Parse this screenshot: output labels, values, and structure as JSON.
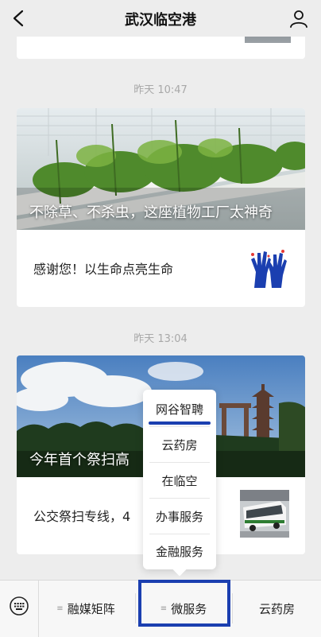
{
  "header": {
    "title": "武汉临空港",
    "back_icon": "chevron-left-icon",
    "profile_icon": "person-icon"
  },
  "feed": {
    "articles": [
      {
        "time": "昨天 10:47",
        "headline": "不除草、不杀虫，这座植物工厂太神奇",
        "sub_title": "感谢您！以生命点亮生命"
      },
      {
        "time": "昨天 13:04",
        "headline": "今年首个祭扫高",
        "sub_title": "公交祭扫专线，4"
      }
    ]
  },
  "popup_menu": {
    "items": [
      "网谷智聘",
      "云药房",
      "在临空",
      "办事服务",
      "金融服务"
    ]
  },
  "tabbar": {
    "keyboard_icon": "keyboard-icon",
    "tabs": [
      "融媒矩阵",
      "微服务",
      "云药房"
    ],
    "menu_glyph": "≡"
  },
  "colors": {
    "accent": "#1b3fb0",
    "background": "#ededed"
  }
}
